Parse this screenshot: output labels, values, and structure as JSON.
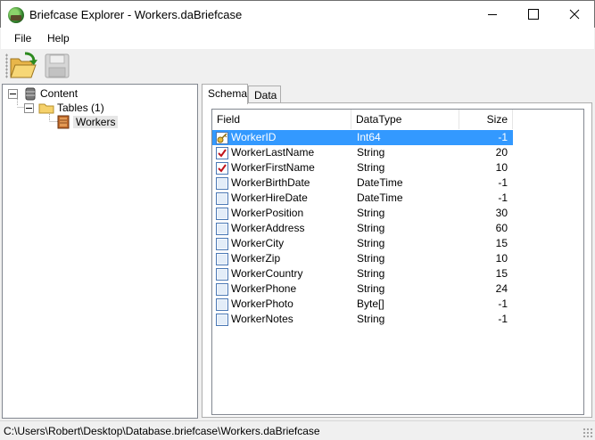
{
  "window": {
    "title": "Briefcase Explorer - Workers.daBriefcase"
  },
  "menu": {
    "items": [
      "File",
      "Help"
    ]
  },
  "toolbar": {
    "buttons": [
      {
        "icon": "open-folder-icon",
        "enabled": true
      },
      {
        "icon": "save-disk-icon",
        "enabled": false
      }
    ]
  },
  "tree": {
    "root": "Content",
    "tables": "Tables (1)",
    "table_items": [
      "Workers"
    ]
  },
  "tabs": [
    "Schema",
    "Data"
  ],
  "active_tab": "Schema",
  "grid": {
    "columns": [
      "Field",
      "DataType",
      "Size"
    ],
    "rows": [
      {
        "field": "WorkerID",
        "type": "Int64",
        "size": "-1",
        "icon": "key-icon",
        "selected": true
      },
      {
        "field": "WorkerLastName",
        "type": "String",
        "size": "20",
        "icon": "required-check-icon"
      },
      {
        "field": "WorkerFirstName",
        "type": "String",
        "size": "10",
        "icon": "required-check-icon"
      },
      {
        "field": "WorkerBirthDate",
        "type": "DateTime",
        "size": "-1",
        "icon": "field-icon"
      },
      {
        "field": "WorkerHireDate",
        "type": "DateTime",
        "size": "-1",
        "icon": "field-icon"
      },
      {
        "field": "WorkerPosition",
        "type": "String",
        "size": "30",
        "icon": "field-icon"
      },
      {
        "field": "WorkerAddress",
        "type": "String",
        "size": "60",
        "icon": "field-icon"
      },
      {
        "field": "WorkerCity",
        "type": "String",
        "size": "15",
        "icon": "field-icon"
      },
      {
        "field": "WorkerZip",
        "type": "String",
        "size": "10",
        "icon": "field-icon"
      },
      {
        "field": "WorkerCountry",
        "type": "String",
        "size": "15",
        "icon": "field-icon"
      },
      {
        "field": "WorkerPhone",
        "type": "String",
        "size": "24",
        "icon": "field-icon"
      },
      {
        "field": "WorkerPhoto",
        "type": "Byte[]",
        "size": "-1",
        "icon": "field-icon"
      },
      {
        "field": "WorkerNotes",
        "type": "String",
        "size": "-1",
        "icon": "field-icon"
      }
    ]
  },
  "status": {
    "path": "C:\\Users\\Robert\\Desktop\\Database.briefcase\\Workers.daBriefcase"
  },
  "colors": {
    "selection": "#3399ff",
    "window_bg": "#f0f0f0"
  }
}
